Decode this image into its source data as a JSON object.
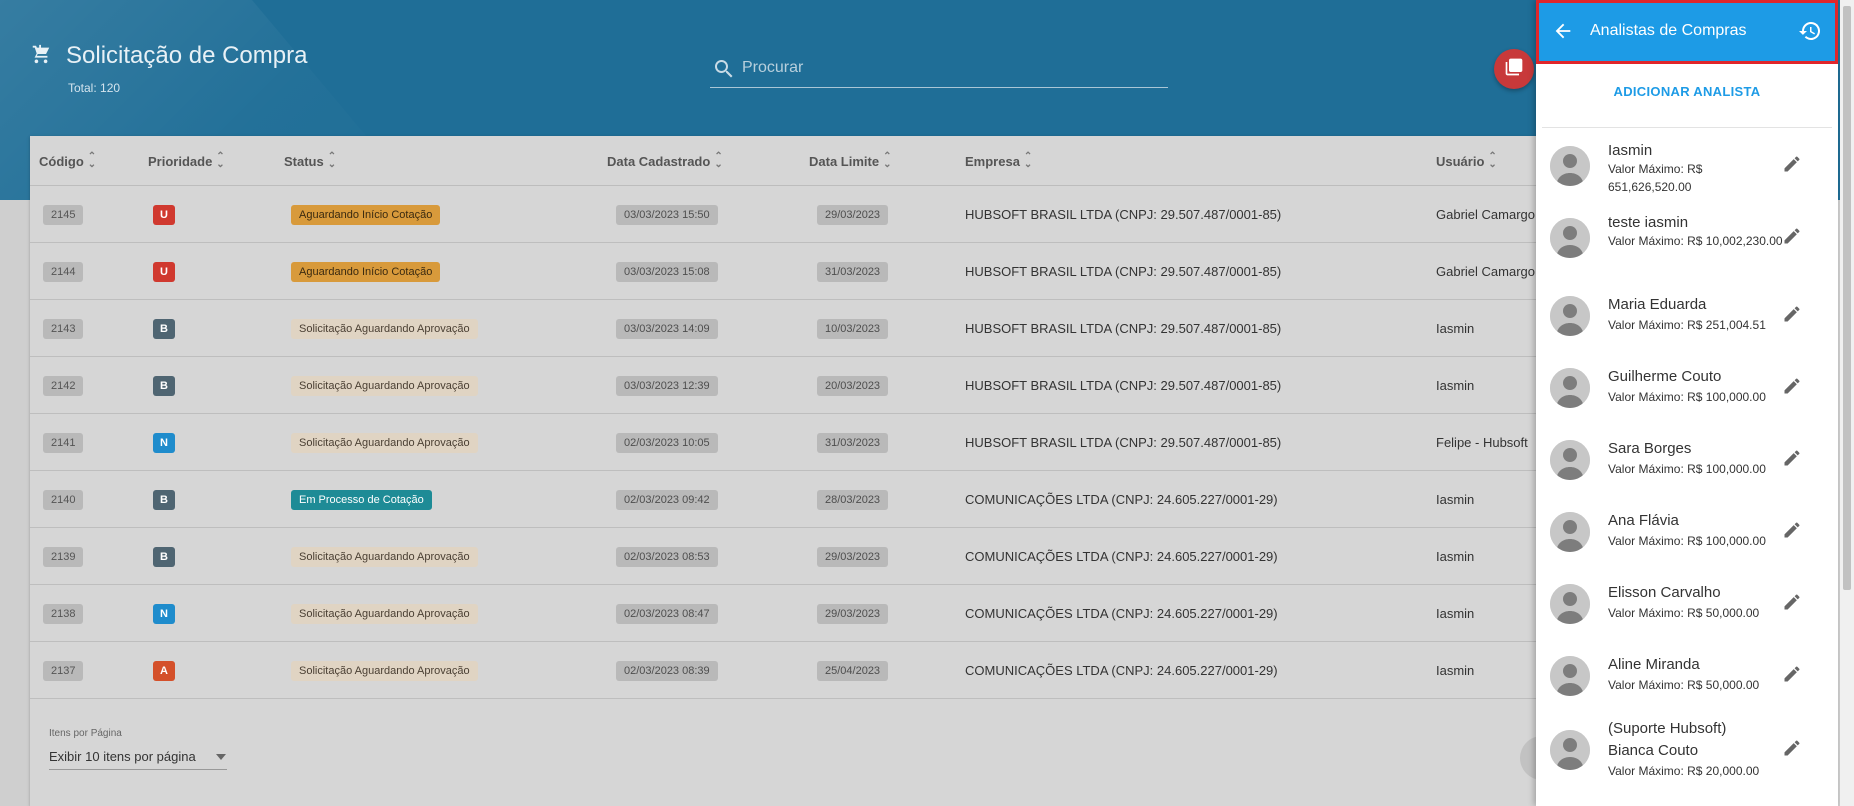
{
  "page": {
    "title": "Solicitação de Compra",
    "total": "Total: 120",
    "search_placeholder": "Procurar"
  },
  "table": {
    "headers": [
      "Código",
      "Prioridade",
      "Status",
      "Data Cadastrado",
      "Data Limite",
      "Empresa",
      "Usuário"
    ],
    "rows": [
      {
        "code": "2145",
        "priority": "U",
        "priority_color": "#d0392f",
        "status": "Aguardando Início Cotação",
        "status_style": "orange",
        "created": "03/03/2023 15:50",
        "limit": "29/03/2023",
        "company": "HUBSOFT BRASIL LTDA (CNPJ: 29.507.487/0001-85)",
        "user": "Gabriel Camargo"
      },
      {
        "code": "2144",
        "priority": "U",
        "priority_color": "#d0392f",
        "status": "Aguardando Início Cotação",
        "status_style": "orange",
        "created": "03/03/2023 15:08",
        "limit": "31/03/2023",
        "company": "HUBSOFT BRASIL LTDA (CNPJ: 29.507.487/0001-85)",
        "user": "Gabriel Camargo"
      },
      {
        "code": "2143",
        "priority": "B",
        "priority_color": "#4f6572",
        "status": "Solicitação Aguardando Aprovação",
        "status_style": "beige",
        "created": "03/03/2023 14:09",
        "limit": "10/03/2023",
        "company": "HUBSOFT BRASIL LTDA (CNPJ: 29.507.487/0001-85)",
        "user": "Iasmin"
      },
      {
        "code": "2142",
        "priority": "B",
        "priority_color": "#4f6572",
        "status": "Solicitação Aguardando Aprovação",
        "status_style": "beige",
        "created": "03/03/2023 12:39",
        "limit": "20/03/2023",
        "company": "HUBSOFT BRASIL LTDA (CNPJ: 29.507.487/0001-85)",
        "user": "Iasmin"
      },
      {
        "code": "2141",
        "priority": "N",
        "priority_color": "#1f8ccc",
        "status": "Solicitação Aguardando Aprovação",
        "status_style": "beige",
        "created": "02/03/2023 10:05",
        "limit": "31/03/2023",
        "company": "HUBSOFT BRASIL LTDA (CNPJ: 29.507.487/0001-85)",
        "user": "Felipe - Hubsoft"
      },
      {
        "code": "2140",
        "priority": "B",
        "priority_color": "#4f6572",
        "status": "Em Processo de Cotação",
        "status_style": "teal",
        "created": "02/03/2023 09:42",
        "limit": "28/03/2023",
        "company": "COMUNICAÇÕES LTDA (CNPJ: 24.605.227/0001-29)",
        "user": "Iasmin"
      },
      {
        "code": "2139",
        "priority": "B",
        "priority_color": "#4f6572",
        "status": "Solicitação Aguardando Aprovação",
        "status_style": "beige",
        "created": "02/03/2023 08:53",
        "limit": "29/03/2023",
        "company": "COMUNICAÇÕES LTDA (CNPJ: 24.605.227/0001-29)",
        "user": "Iasmin"
      },
      {
        "code": "2138",
        "priority": "N",
        "priority_color": "#1f8ccc",
        "status": "Solicitação Aguardando Aprovação",
        "status_style": "beige",
        "created": "02/03/2023 08:47",
        "limit": "29/03/2023",
        "company": "COMUNICAÇÕES LTDA (CNPJ: 24.605.227/0001-29)",
        "user": "Iasmin"
      },
      {
        "code": "2137",
        "priority": "A",
        "priority_color": "#d4502a",
        "status": "Solicitação Aguardando Aprovação",
        "status_style": "beige",
        "created": "02/03/2023 08:39",
        "limit": "25/04/2023",
        "company": "COMUNICAÇÕES LTDA (CNPJ: 24.605.227/0001-29)",
        "user": "Iasmin"
      }
    ]
  },
  "pagination": {
    "label": "Itens por Página",
    "selected": "Exibir 10 itens por página"
  },
  "drawer": {
    "title": "Analistas de Compras",
    "add_label": "ADICIONAR ANALISTA",
    "analysts": [
      {
        "name": "Iasmin",
        "value": "Valor Máximo: R$ 651,626,520.00"
      },
      {
        "name": "teste iasmin",
        "value": "Valor Máximo: R$ 10,002,230.00"
      },
      {
        "name": "Maria Eduarda",
        "value": "Valor Máximo: R$ 251,004.51"
      },
      {
        "name": "Guilherme Couto",
        "value": "Valor Máximo: R$ 100,000.00"
      },
      {
        "name": "Sara Borges",
        "value": "Valor Máximo: R$ 100,000.00"
      },
      {
        "name": "Ana Flávia",
        "value": "Valor Máximo: R$ 100,000.00"
      },
      {
        "name": "Elisson Carvalho",
        "value": "Valor Máximo: R$ 50,000.00"
      },
      {
        "name": "Aline Miranda",
        "value": "Valor Máximo: R$ 50,000.00"
      },
      {
        "name": "(Suporte Hubsoft) Bianca Couto",
        "value": "Valor Máximo: R$ 20,000.00"
      }
    ]
  },
  "colors": {
    "header": "#1f6e97",
    "drawer_accent": "#1d9be6",
    "highlight_border": "#e0262b",
    "pdf_button": "#c8393a"
  },
  "icons": {
    "title": "cart-download-icon",
    "search": "search-icon",
    "pdf": "pdf-icon",
    "back": "arrow-left-icon",
    "history": "history-icon",
    "edit": "pencil-icon",
    "avatar": "person-avatar-icon",
    "dropdown": "caret-down-icon"
  }
}
